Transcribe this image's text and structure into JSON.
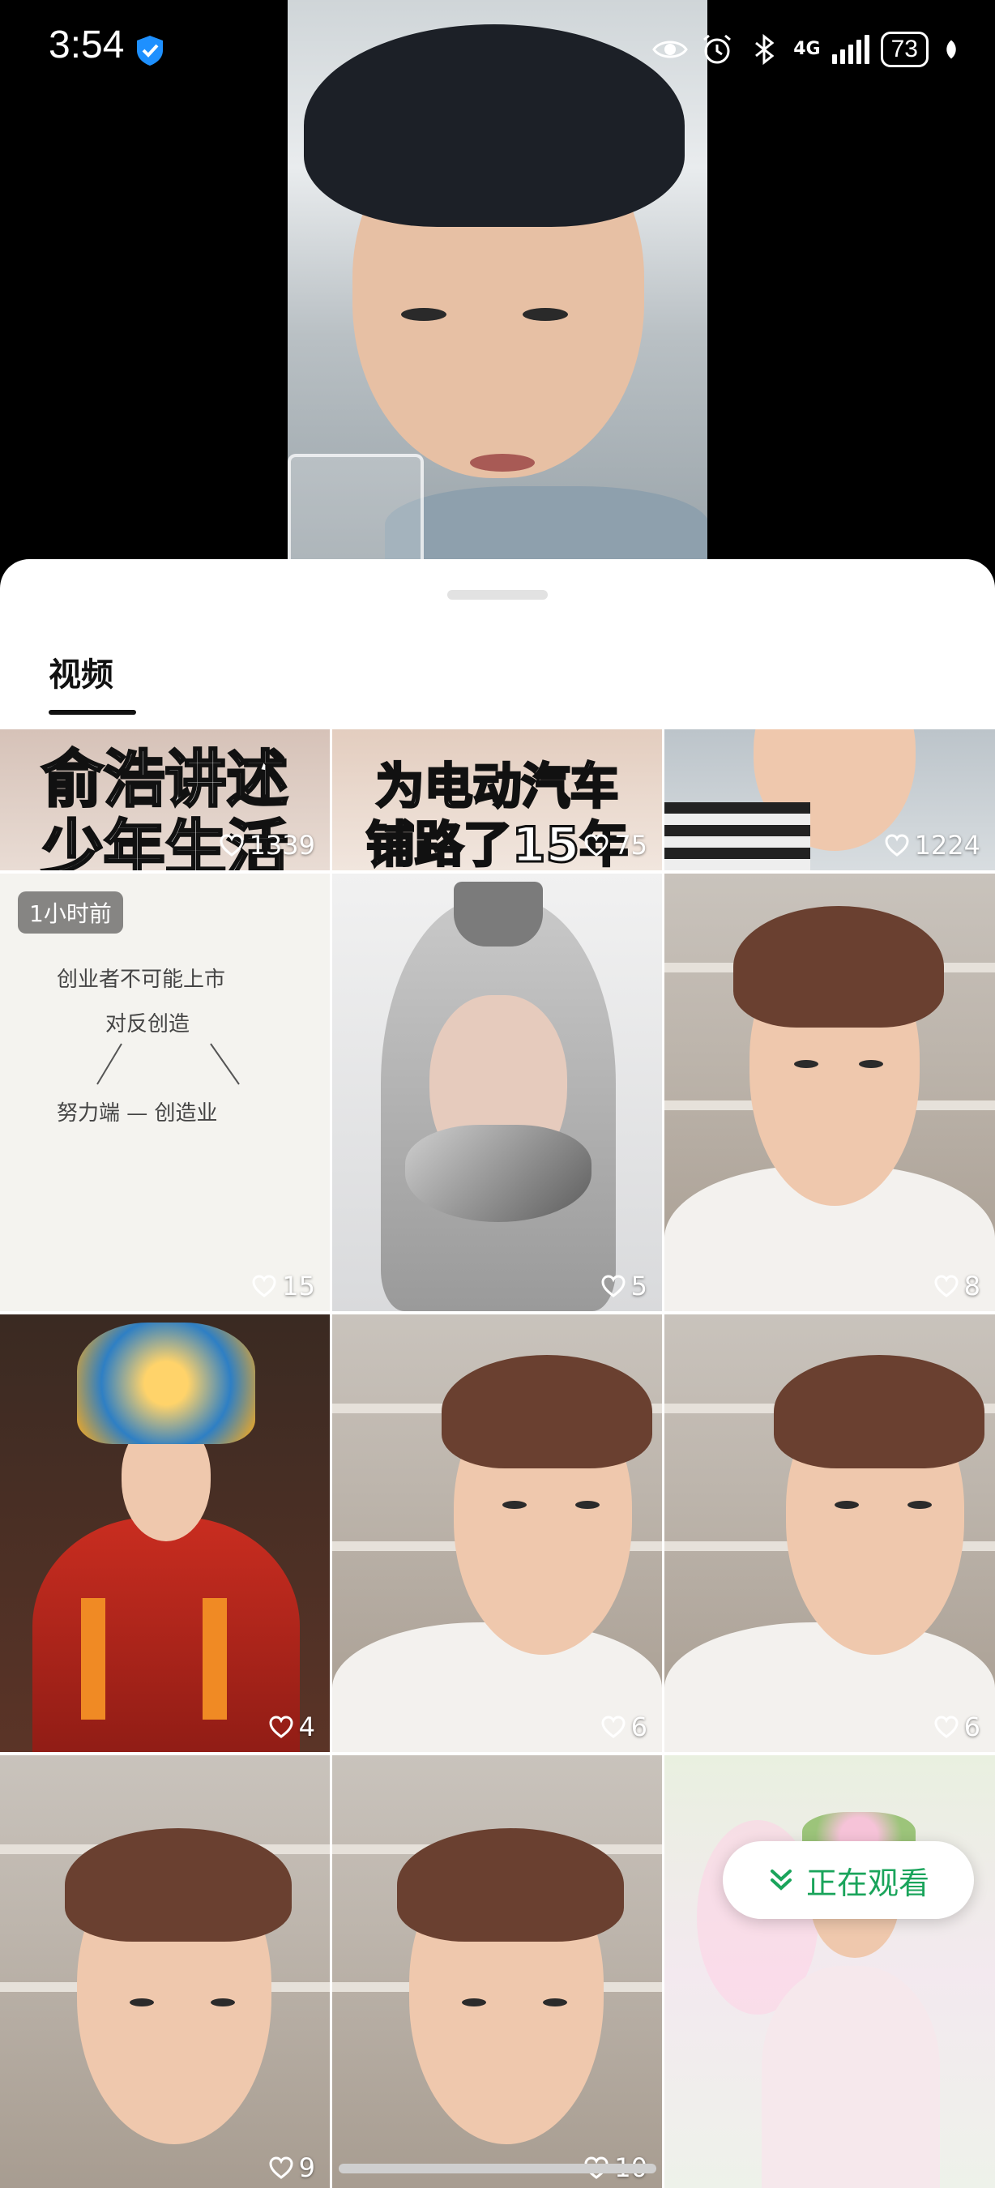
{
  "status_bar": {
    "time": "3:54",
    "network": "4G",
    "battery": "73"
  },
  "sheet": {
    "tab_label": "视频"
  },
  "grid": {
    "row0": [
      {
        "caption_line1": "俞浩讲述",
        "caption_line2": "少年生活",
        "likes": "1339"
      },
      {
        "caption_line1": "为电动汽车",
        "caption_line2": "铺路了15年",
        "likes": "75"
      },
      {
        "likes": "1224"
      }
    ],
    "row1": [
      {
        "badge": "1小时前",
        "note_line1": "创业者不可能上市",
        "note_line2": "对反创造",
        "note_line3": "努力端 — 创造业",
        "likes": "15"
      },
      {
        "likes": "5"
      },
      {
        "likes": "8"
      }
    ],
    "row2": [
      {
        "likes": "4"
      },
      {
        "likes": "6"
      },
      {
        "likes": "6"
      }
    ],
    "row3": [
      {
        "likes": "9"
      },
      {
        "likes": "10"
      },
      {
        "likes": ""
      }
    ]
  },
  "watching_button": {
    "label": "正在观看"
  }
}
